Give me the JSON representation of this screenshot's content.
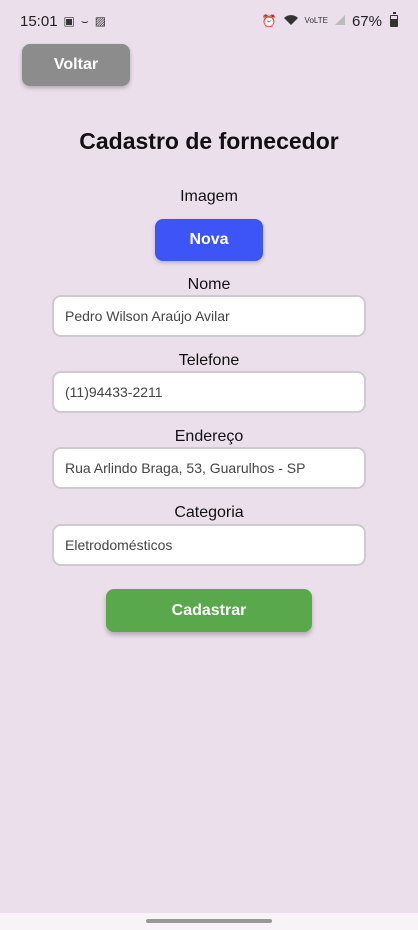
{
  "status_bar": {
    "time": "15:01",
    "battery": "67%",
    "left_icons": [
      "sim-icon",
      "cast-icon",
      "gallery-icon"
    ],
    "right_icons": [
      "alarm-icon",
      "wifi-icon",
      "volte-icon",
      "signal-icon",
      "battery-icon"
    ]
  },
  "header": {
    "back_label": "Voltar",
    "title": "Cadastro de fornecedor"
  },
  "form": {
    "image_label": "Imagem",
    "new_image_label": "Nova",
    "name_label": "Nome",
    "name_value": "Pedro Wilson Araújo Avilar",
    "phone_label": "Telefone",
    "phone_value": "(11)94433-2211",
    "address_label": "Endereço",
    "address_value": "Rua Arlindo Braga, 53, Guarulhos - SP",
    "category_label": "Categoria",
    "category_value": "Eletrodomésticos",
    "submit_label": "Cadastrar"
  },
  "colors": {
    "background": "#ECDFEC",
    "back_button": "#8C8C8C",
    "new_button": "#3D55F6",
    "submit_button": "#59A84B"
  }
}
